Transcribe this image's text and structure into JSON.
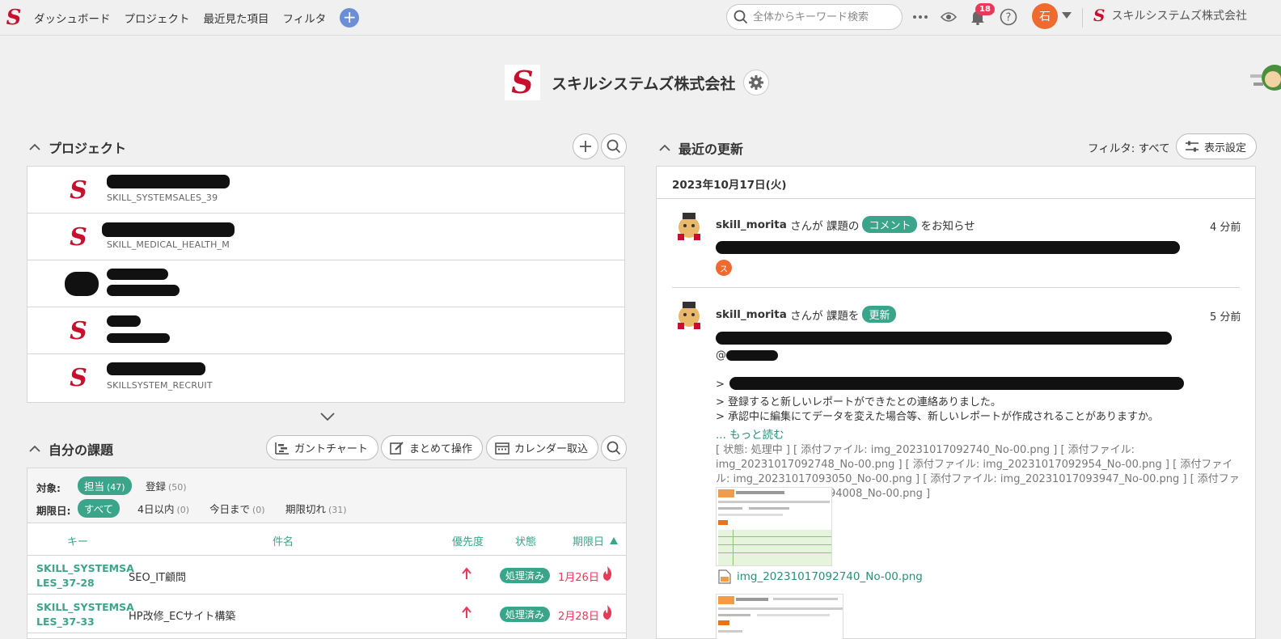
{
  "nav": {
    "items": [
      "ダッシュボード",
      "プロジェクト",
      "最近見た項目",
      "フィルタ"
    ],
    "search_placeholder": "全体からキーワード検索",
    "notification_count": "18",
    "user_initial": "石",
    "org_name": "スキルシステムズ株式会社"
  },
  "space": {
    "title": "スキルシステムズ株式会社"
  },
  "projects": {
    "title": "プロジェクト",
    "rows": [
      {
        "key": "SKILL_SYSTEMSALES_39"
      },
      {
        "key": "SKILL_MEDICAL_HEALTH_M"
      },
      {
        "key": ""
      },
      {
        "key": ""
      },
      {
        "key": "SKILLSYSTEM_RECRUIT"
      }
    ]
  },
  "my_issues": {
    "title": "自分の課題",
    "buttons": {
      "gantt": "ガントチャート",
      "bulk": "まとめて操作",
      "calendar": "カレンダー取込"
    },
    "target_label": "対象:",
    "targets": [
      {
        "label": "担当",
        "count": "(47)"
      },
      {
        "label": "登録",
        "count": "(50)"
      }
    ],
    "due_label": "期限日:",
    "due_filters": [
      {
        "label": "すべて",
        "count": ""
      },
      {
        "label": "4日以内",
        "count": "(0)"
      },
      {
        "label": "今日まで",
        "count": "(0)"
      },
      {
        "label": "期限切れ",
        "count": "(31)"
      }
    ],
    "columns": {
      "key": "キー",
      "subject": "件名",
      "priority": "優先度",
      "status": "状態",
      "due": "期限日"
    },
    "rows": [
      {
        "key": "SKILL_SYSTEMSALES_37-28",
        "key_line1": "SKILL_SYSTEMSA",
        "key_line2": "LES_37-28",
        "subject": "SEO_IT顧問",
        "status": "処理済み",
        "due": "1月26日"
      },
      {
        "key": "SKILL_SYSTEMSALES_37-33",
        "key_line1": "SKILL_SYSTEMSA",
        "key_line2": "LES_37-33",
        "subject": "HP改修_ECサイト構築",
        "status": "処理済み",
        "due": "2月28日"
      }
    ]
  },
  "updates": {
    "title": "最近の更新",
    "filter_text": "フィルタ: すべて",
    "display_button": "表示設定",
    "date": "2023年10月17日(火)",
    "activities": [
      {
        "user": "skill_morita",
        "pre": "さんが 課題の",
        "tag": "コメント",
        "post": "をお知らせ",
        "time": "4 分前",
        "mini_avatar": "ス"
      },
      {
        "user": "skill_morita",
        "pre": "さんが 課題を",
        "tag": "更新",
        "post": "",
        "time": "5 分前",
        "mention": "@",
        "quote_lines": [
          "> ",
          "> 登録すると新しいレポートができたとの連絡ありました。",
          "> 承認中に編集にてデータを変えた場合等、新しいレポートが作成されることがありますか。"
        ],
        "more": "... もっと読む",
        "meta": "[ 状態: 処理中 ] [ 添付ファイル: img_20231017092740_No-00.png ] [ 添付ファイル: img_20231017092748_No-00.png ] [ 添付ファイル: img_20231017092954_No-00.png ] [ 添付ファイル: img_20231017093050_No-00.png ] [ 添付ファイル: img_20231017093947_No-00.png ] [ 添付ファイル: img_20231017094008_No-00.png ]",
        "file": "img_20231017092740_No-00.png"
      }
    ]
  },
  "colors": {
    "accent": "#3aa58a",
    "danger": "#e8395a",
    "logo": "#c8102e",
    "avatar": "#ee6a2f"
  }
}
